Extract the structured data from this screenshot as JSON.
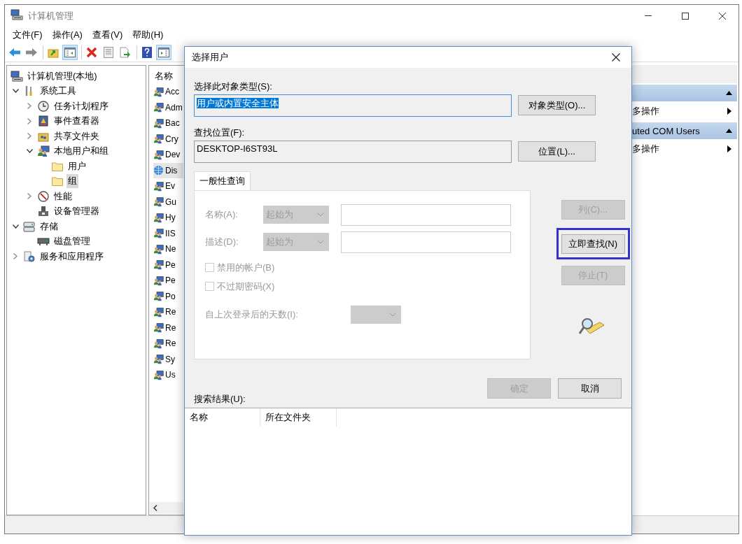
{
  "window": {
    "title": "计算机管理"
  },
  "menu": [
    "文件(F)",
    "操作(A)",
    "查看(V)",
    "帮助(H)"
  ],
  "toolbar": [
    {
      "kind": "back",
      "pressed": false
    },
    {
      "kind": "forward",
      "pressed": false
    },
    {
      "kind": "up",
      "pressed": false
    },
    {
      "kind": "tree",
      "pressed": true
    },
    {
      "kind": "delete",
      "pressed": false
    },
    {
      "kind": "properties",
      "pressed": false
    },
    {
      "kind": "export",
      "pressed": false
    },
    {
      "kind": "help",
      "pressed": false
    },
    {
      "kind": "actionpane",
      "pressed": true
    }
  ],
  "tree": {
    "items": [
      {
        "label": "计算机管理(本地)",
        "kind": "computer",
        "selected": false,
        "children": [
          {
            "label": "系统工具",
            "kind": "tools",
            "expanded": true,
            "selected": false,
            "children": [
              {
                "label": "任务计划程序",
                "kind": "clock",
                "expanded": false,
                "selected": false
              },
              {
                "label": "事件查看器",
                "kind": "event",
                "expanded": false,
                "selected": false
              },
              {
                "label": "共享文件夹",
                "kind": "share",
                "expanded": false,
                "selected": false
              },
              {
                "label": "本地用户和组",
                "kind": "users",
                "expanded": true,
                "selected": false,
                "children": [
                  {
                    "label": "用户",
                    "kind": "folder",
                    "selected": false
                  },
                  {
                    "label": "组",
                    "kind": "folder",
                    "selected": true
                  }
                ]
              },
              {
                "label": "性能",
                "kind": "perf",
                "expanded": false,
                "selected": false
              },
              {
                "label": "设备管理器",
                "kind": "device",
                "selected": false
              }
            ]
          },
          {
            "label": "存储",
            "kind": "storage",
            "expanded": true,
            "selected": false,
            "children": [
              {
                "label": "磁盘管理",
                "kind": "disk",
                "selected": false
              }
            ]
          },
          {
            "label": "服务和应用程序",
            "kind": "services",
            "expanded": false,
            "selected": false
          }
        ]
      }
    ]
  },
  "list": {
    "header": "名称",
    "items": [
      {
        "label": "Acc",
        "kind": "group",
        "selected": false
      },
      {
        "label": "Adm",
        "kind": "group",
        "selected": false
      },
      {
        "label": "Bac",
        "kind": "group",
        "selected": false
      },
      {
        "label": "Cry",
        "kind": "group",
        "selected": false
      },
      {
        "label": "Dev",
        "kind": "group",
        "selected": false
      },
      {
        "label": "Dis",
        "kind": "network",
        "selected": true
      },
      {
        "label": "Ev",
        "kind": "group",
        "selected": false
      },
      {
        "label": "Gu",
        "kind": "group",
        "selected": false
      },
      {
        "label": "Hy",
        "kind": "group",
        "selected": false
      },
      {
        "label": "IIS",
        "kind": "group",
        "selected": false
      },
      {
        "label": "Ne",
        "kind": "group",
        "selected": false
      },
      {
        "label": "Pe",
        "kind": "group",
        "selected": false
      },
      {
        "label": "Pe",
        "kind": "group",
        "selected": false
      },
      {
        "label": "Po",
        "kind": "group",
        "selected": false
      },
      {
        "label": "Re",
        "kind": "group",
        "selected": false
      },
      {
        "label": "Re",
        "kind": "group",
        "selected": false
      },
      {
        "label": "Re",
        "kind": "group",
        "selected": false
      },
      {
        "label": "Sy",
        "kind": "group",
        "selected": false
      },
      {
        "label": "Us",
        "kind": "group",
        "selected": false
      }
    ]
  },
  "actions": {
    "sections": [
      {
        "expanded": true,
        "more": "多操作"
      },
      {
        "title": "uted COM Users",
        "expanded": true,
        "more": "多操作"
      }
    ]
  },
  "dialog": {
    "title": "选择用户",
    "object_type": {
      "label": "选择此对象类型(S):",
      "value": "用户或内置安全主体",
      "text_selected": true,
      "button": "对象类型(O)..."
    },
    "location": {
      "label": "查找位置(F):",
      "value": "DESKTOP-I6ST93L",
      "text_selected": false,
      "button": "位置(L)..."
    },
    "tabs": [
      {
        "label": "一般性查询",
        "selected": true
      }
    ],
    "query": {
      "disabled": true,
      "rows": [
        {
          "label": "名称(A):",
          "mode": "起始为"
        },
        {
          "label": "描述(D):",
          "mode": "起始为"
        }
      ],
      "checkboxes": [
        {
          "label": "禁用的帐户(B)",
          "checked": false
        },
        {
          "label": "不过期密码(X)",
          "checked": false
        }
      ],
      "days_label": "自上次登录后的天数(I):"
    },
    "side_buttons": [
      {
        "label": "列(C)...",
        "disabled": true,
        "highlighted": false
      },
      {
        "label": "立即查找(N)",
        "disabled": false,
        "highlighted": true
      },
      {
        "label": "停止(T)",
        "disabled": true,
        "highlighted": false
      }
    ],
    "buttons": [
      {
        "label": "确定",
        "disabled": true
      },
      {
        "label": "取消",
        "disabled": false
      }
    ],
    "results": {
      "label": "搜索结果(U):",
      "columns": [
        "名称",
        "所在文件夹"
      ]
    }
  }
}
